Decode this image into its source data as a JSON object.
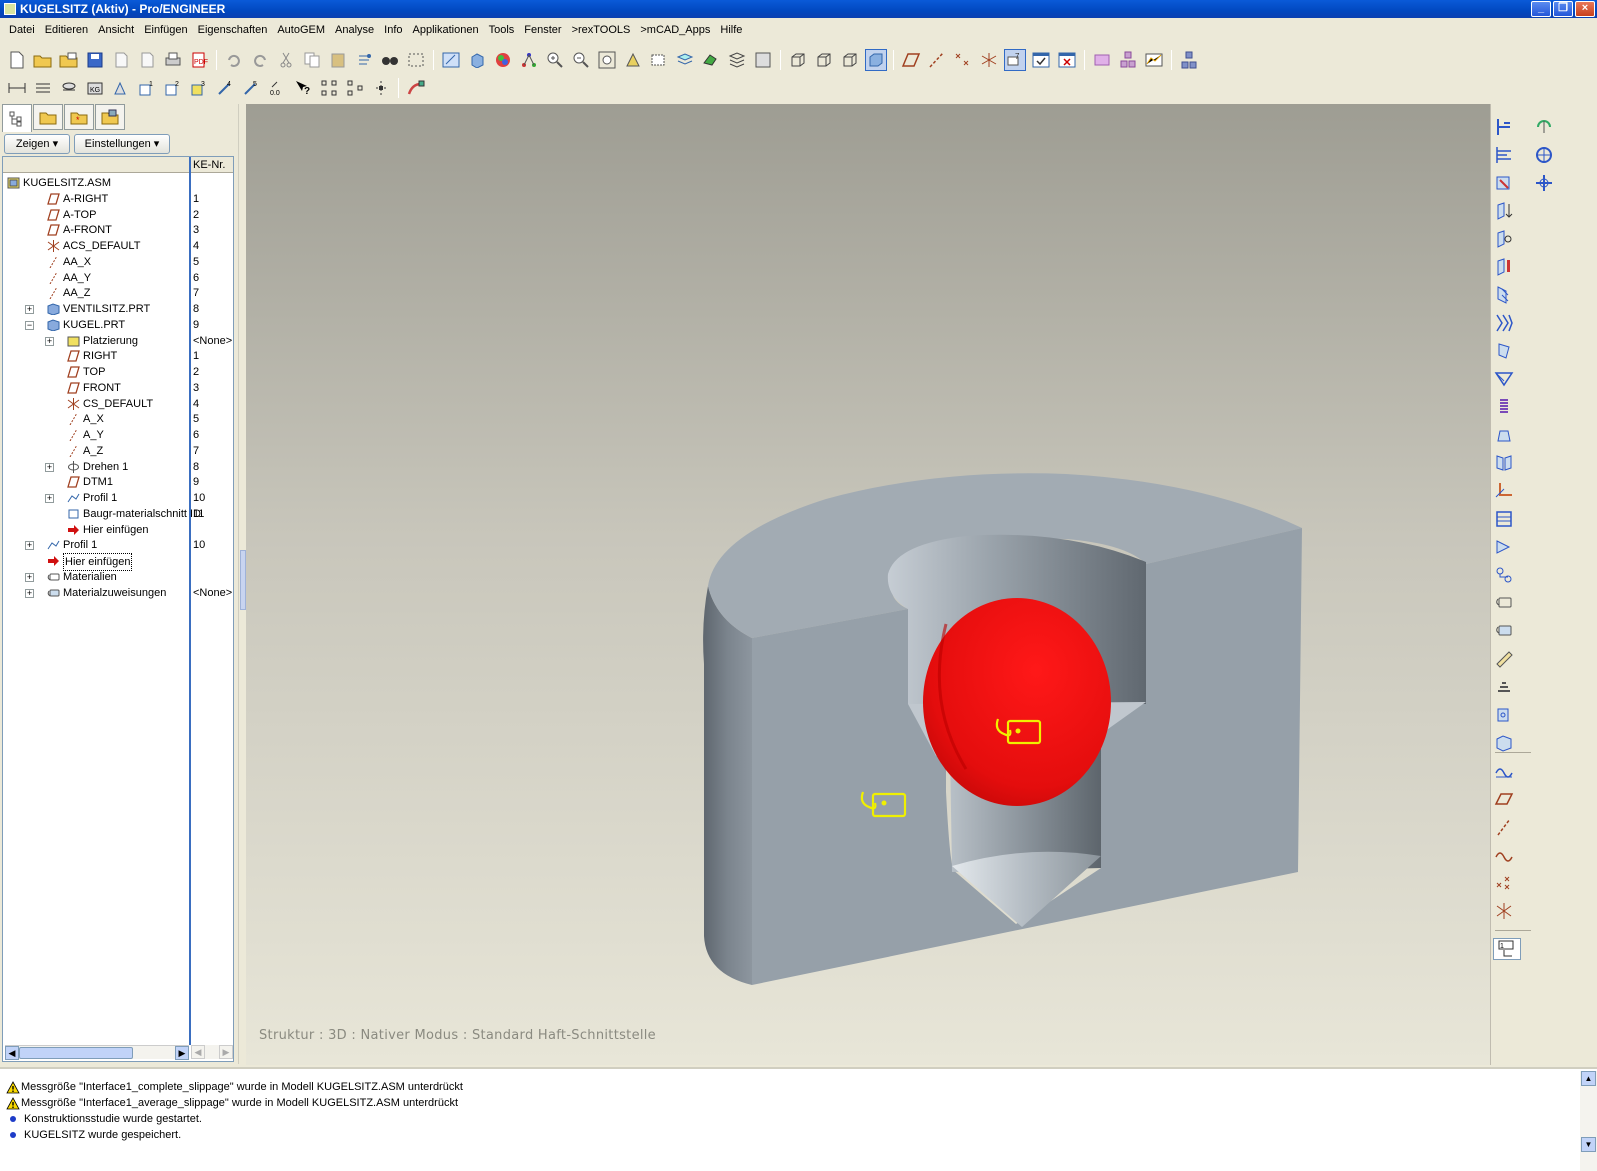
{
  "window": {
    "title": "KUGELSITZ (Aktiv) - Pro/ENGINEER",
    "minimize": "_",
    "restore": "❐",
    "close": "×"
  },
  "menu": [
    "Datei",
    "Editieren",
    "Ansicht",
    "Einfügen",
    "Eigenschaften",
    "AutoGEM",
    "Analyse",
    "Info",
    "Applikationen",
    "Tools",
    "Fenster",
    ">rexTOOLS",
    ">mCAD_Apps",
    "Hilfe"
  ],
  "leftpanel": {
    "show_button": "Zeigen",
    "settings_button": "Einstellungen",
    "column_header": "KE-Nr.",
    "tree": [
      {
        "label": "KUGELSITZ.ASM",
        "num": "",
        "indent": 0,
        "icon": "assembly-icon",
        "exp": ""
      },
      {
        "label": "A-RIGHT",
        "num": "1",
        "indent": 1,
        "icon": "datum-plane-icon",
        "exp": ""
      },
      {
        "label": "A-TOP",
        "num": "2",
        "indent": 1,
        "icon": "datum-plane-icon",
        "exp": ""
      },
      {
        "label": "A-FRONT",
        "num": "3",
        "indent": 1,
        "icon": "datum-plane-icon",
        "exp": ""
      },
      {
        "label": "ACS_DEFAULT",
        "num": "4",
        "indent": 1,
        "icon": "coordinate-system-icon",
        "exp": ""
      },
      {
        "label": "AA_X",
        "num": "5",
        "indent": 1,
        "icon": "datum-axis-icon",
        "exp": ""
      },
      {
        "label": "AA_Y",
        "num": "6",
        "indent": 1,
        "icon": "datum-axis-icon",
        "exp": ""
      },
      {
        "label": "AA_Z",
        "num": "7",
        "indent": 1,
        "icon": "datum-axis-icon",
        "exp": ""
      },
      {
        "label": "VENTILSITZ.PRT",
        "num": "8",
        "indent": 1,
        "icon": "part-icon",
        "exp": "+"
      },
      {
        "label": "KUGEL.PRT",
        "num": "9",
        "indent": 1,
        "icon": "part-icon",
        "exp": "-"
      },
      {
        "label": "Platzierung",
        "num": "<None>",
        "indent": 2,
        "icon": "placement-icon",
        "exp": "+"
      },
      {
        "label": "RIGHT",
        "num": "1",
        "indent": 2,
        "icon": "datum-plane-icon",
        "exp": ""
      },
      {
        "label": "TOP",
        "num": "2",
        "indent": 2,
        "icon": "datum-plane-icon",
        "exp": ""
      },
      {
        "label": "FRONT",
        "num": "3",
        "indent": 2,
        "icon": "datum-plane-icon",
        "exp": ""
      },
      {
        "label": "CS_DEFAULT",
        "num": "4",
        "indent": 2,
        "icon": "coordinate-system-icon",
        "exp": ""
      },
      {
        "label": "A_X",
        "num": "5",
        "indent": 2,
        "icon": "datum-axis-icon",
        "exp": ""
      },
      {
        "label": "A_Y",
        "num": "6",
        "indent": 2,
        "icon": "datum-axis-icon",
        "exp": ""
      },
      {
        "label": "A_Z",
        "num": "7",
        "indent": 2,
        "icon": "datum-axis-icon",
        "exp": ""
      },
      {
        "label": "Drehen 1",
        "num": "8",
        "indent": 2,
        "icon": "revolve-icon",
        "exp": "+"
      },
      {
        "label": "DTM1",
        "num": "9",
        "indent": 2,
        "icon": "datum-plane-icon",
        "exp": ""
      },
      {
        "label": "Profil 1",
        "num": "10",
        "indent": 2,
        "icon": "profile-icon",
        "exp": "+"
      },
      {
        "label": "Baugr-materialschnitt ID",
        "num": "11",
        "indent": 2,
        "icon": "cut-icon",
        "exp": ""
      },
      {
        "label": "Hier einfügen",
        "num": "",
        "indent": 2,
        "icon": "insert-arrow-icon",
        "exp": ""
      },
      {
        "label": "Profil 1",
        "num": "10",
        "indent": 1,
        "icon": "profile-icon",
        "exp": "+"
      },
      {
        "label": "Hier einfügen",
        "num": "",
        "indent": 1,
        "icon": "insert-arrow-icon",
        "exp": "",
        "boxed": true
      },
      {
        "label": "Materialien",
        "num": "",
        "indent": 1,
        "icon": "materials-icon",
        "exp": "+"
      },
      {
        "label": "Materialzuweisungen",
        "num": "<None>",
        "indent": 1,
        "icon": "material-assign-icon",
        "exp": "+"
      }
    ]
  },
  "viewport": {
    "status": "Struktur : 3D : Nativer Modus : Standard Haft-Schnittstelle",
    "colors": {
      "body": "#9aa3ad",
      "body_dark": "#6e7780",
      "ball": "#e01010",
      "tag": "#f0f000"
    }
  },
  "messages": [
    {
      "type": "warning",
      "text": "Messgröße \"Interface1_complete_slippage\" wurde in Modell KUGELSITZ.ASM unterdrückt"
    },
    {
      "type": "warning",
      "text": "Messgröße \"Interface1_average_slippage\" wurde in Modell KUGELSITZ.ASM unterdrückt"
    },
    {
      "type": "info",
      "text": "Konstruktionsstudie wurde gestartet."
    },
    {
      "type": "info",
      "text": "KUGELSITZ wurde gespeichert."
    }
  ]
}
